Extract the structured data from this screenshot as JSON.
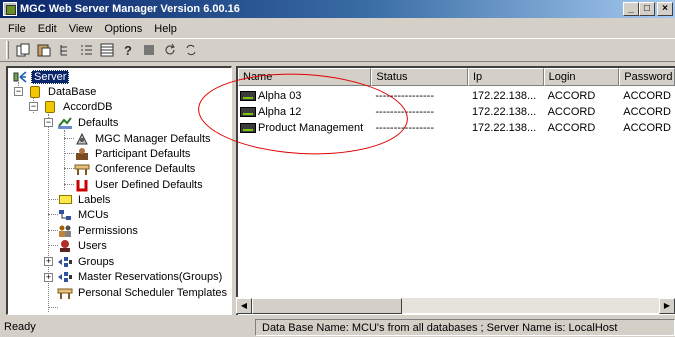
{
  "window": {
    "title": "MGC Web Server Manager Version 6.00.16",
    "minimize": "_",
    "maximize": "□",
    "close": "×"
  },
  "menu": [
    "File",
    "Edit",
    "View",
    "Options",
    "Help"
  ],
  "toolbar": {
    "icons": [
      "copy-icon",
      "paste-icon",
      "tree-icon",
      "list-icon",
      "details-icon",
      "help-icon",
      "stop-icon",
      "refresh-icon",
      "sync-icon"
    ]
  },
  "tree": {
    "server": "Server",
    "database": "DataBase",
    "accorddb": "AccordDB",
    "defaults": "Defaults",
    "mgc_defaults": "MGC Manager Defaults",
    "participant_defaults": "Participant Defaults",
    "conference_defaults": "Conference Defaults",
    "user_defined_defaults": "User Defined Defaults",
    "labels": "Labels",
    "mcus": "MCUs",
    "permissions": "Permissions",
    "users": "Users",
    "groups": "Groups",
    "master_reservations": "Master Reservations(Groups)",
    "personal_scheduler": "Personal Scheduler Templates",
    "expand_minus": "−",
    "expand_plus": "+"
  },
  "list": {
    "columns": [
      "Name",
      "Status",
      "Ip",
      "Login",
      "Password"
    ],
    "rows": [
      {
        "name": "Alpha 03",
        "status": "----------------",
        "ip": "172.22.138...",
        "login": "ACCORD",
        "password": "ACCORD"
      },
      {
        "name": "Alpha 12",
        "status": "----------------",
        "ip": "172.22.138...",
        "login": "ACCORD",
        "password": "ACCORD"
      },
      {
        "name": "Product Management",
        "status": "----------------",
        "ip": "172.22.138...",
        "login": "ACCORD",
        "password": "ACCORD"
      }
    ]
  },
  "scroll": {
    "left_arrow": "◀",
    "right_arrow": "▶"
  },
  "status": {
    "left": "Ready",
    "right": "Data Base Name: MCU's from all databases ; Server Name is: LocalHost"
  },
  "colors": {
    "title_bar": "#0a246a",
    "selection": "#0a246a",
    "annotation": "#e00000"
  }
}
